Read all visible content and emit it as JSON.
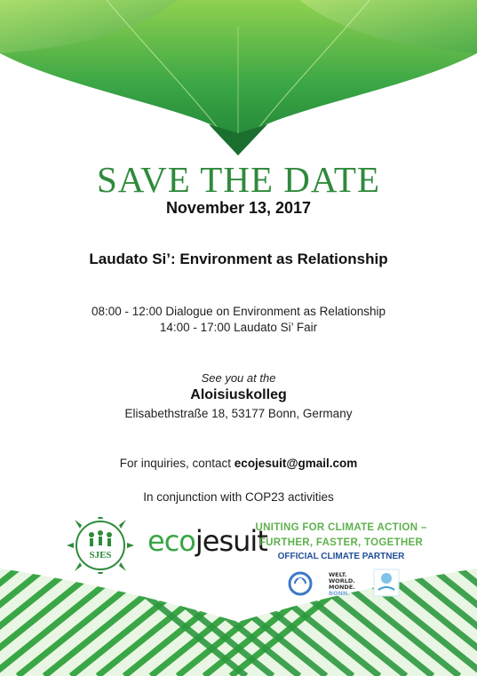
{
  "flyer": {
    "title": "SAVE THE DATE",
    "date": "November 13, 2017",
    "event_title": "Laudato Si’: Environment as Relationship",
    "schedule": [
      "08:00 - 12:00 Dialogue on Environment as Relationship",
      "14:00 - 17:00 Laudato Si’ Fair"
    ],
    "see_you": "See you at the",
    "venue": "Aloisiuskolleg",
    "address": "Elisabethstraße 18, 53177 Bonn, Germany",
    "inquiry_prefix": "For inquiries, contact ",
    "inquiry_email": "ecojesuit@gmail.com",
    "conjunction": "In conjunction with COP23 activities"
  },
  "logos": {
    "sjes_text": "SJES",
    "ecojesuit_part1": "eco",
    "ecojesuit_part2": "jesuit",
    "cop_slogan_line1": "UNITING FOR CLIMATE ACTION –",
    "cop_slogan_line2": "FURTHER, FASTER, TOGETHER",
    "cop_partner": "OFFICIAL CLIMATE PARTNER",
    "welt_line1": "WELT.",
    "welt_line2": "WORLD.",
    "welt_line3": "MONDE.",
    "welt_line4": "BONN."
  },
  "colors": {
    "brand_green": "#2f8a3c",
    "light_green": "#5fb14d",
    "partner_blue": "#1f4f9a"
  },
  "icons": [
    "sjes-logo",
    "un-climate-logo",
    "cop23-badge"
  ]
}
